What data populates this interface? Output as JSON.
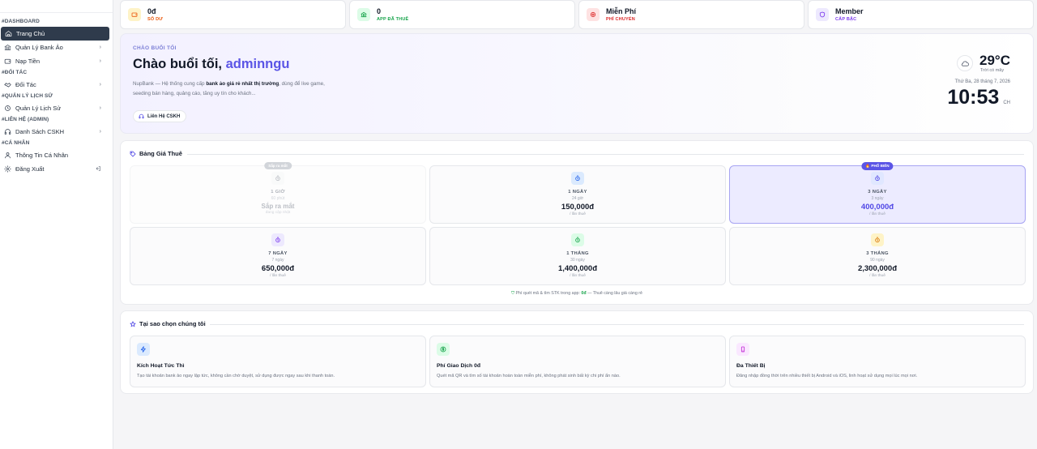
{
  "sidebar": {
    "sections": [
      {
        "title": "#DASHBOARD",
        "items": [
          {
            "label": "Trang Chủ",
            "icon": "home-icon",
            "active": true,
            "chevron": false
          },
          {
            "label": "Quản Lý Bank Ảo",
            "icon": "bank-icon",
            "active": false,
            "chevron": true
          },
          {
            "label": "Nạp Tiền",
            "icon": "wallet-icon",
            "active": false,
            "chevron": true
          }
        ]
      },
      {
        "title": "#ĐỐI TÁC",
        "items": [
          {
            "label": "Đối Tác",
            "icon": "handshake-icon",
            "active": false,
            "chevron": true
          }
        ]
      },
      {
        "title": "#QUẢN LÝ LỊCH SỬ",
        "items": [
          {
            "label": "Quản Lý Lịch Sử",
            "icon": "history-icon",
            "active": false,
            "chevron": true
          }
        ]
      },
      {
        "title": "#LIÊN HỆ (ADMIN)",
        "items": [
          {
            "label": "Danh Sách CSKH",
            "icon": "headset-icon",
            "active": false,
            "chevron": true
          }
        ]
      },
      {
        "title": "#CÁ NHÂN",
        "items": [
          {
            "label": "Thông Tin Cá Nhân",
            "icon": "user-icon",
            "active": false,
            "chevron": false
          },
          {
            "label": "Đăng Xuất",
            "icon": "gear-icon",
            "active": false,
            "chevron": false,
            "trailing": "logout-icon"
          }
        ]
      }
    ]
  },
  "stats": [
    {
      "value": "0đ",
      "label": "SỐ DƯ",
      "icon": "wallet-icon",
      "color": "#ea580c",
      "bg": "#fef3c7"
    },
    {
      "value": "0",
      "label": "APP ĐÃ THUÊ",
      "icon": "bank-icon",
      "color": "#16a34a",
      "bg": "#dcfce7"
    },
    {
      "value": "Miễn Phí",
      "label": "PHÍ CHUYỂN",
      "icon": "target-icon",
      "color": "#dc2626",
      "bg": "#fee2e2"
    },
    {
      "value": "Member",
      "label": "CẤP BẬC",
      "icon": "shield-icon",
      "color": "#7c3aed",
      "bg": "#ede9fe"
    }
  ],
  "hero": {
    "greeting_small": "CHÀO BUỔI TỐI",
    "greeting_prefix": "Chào buổi tối, ",
    "username": "adminngu",
    "desc_pre": "NupBank — Hệ thống cung cấp ",
    "desc_bold": "bank ảo giá rẻ nhất thị trường",
    "desc_post": ", dùng để live game, seeding bán hàng, quảng cáo, tăng uy tín cho khách...",
    "cskh_label": "Liên Hệ CSKH",
    "weather": {
      "temp": "29°C",
      "condition": "Trời có mây",
      "date": "Thứ Ba, 28 tháng 7, 2026",
      "time": "10:53",
      "ampm": "CH"
    }
  },
  "pricing": {
    "title": "Bảng Giá Thuê",
    "plans": [
      {
        "name": "1 GIỜ",
        "sub": "60 phút",
        "price": "Sắp ra mắt",
        "unit": "đang cập nhật",
        "state": "soon",
        "badge": "Sắp ra mắt",
        "color": "#6b7280",
        "bg": "#f3f4f6"
      },
      {
        "name": "1 NGÀY",
        "sub": "24 giờ",
        "price": "150,000đ",
        "unit": "/ lần thuê",
        "state": "normal",
        "badge": "",
        "color": "#2563eb",
        "bg": "#dbeafe"
      },
      {
        "name": "3 NGÀY",
        "sub": "3 ngày",
        "price": "400,000đ",
        "unit": "/ lần thuê",
        "state": "popular",
        "badge": "🔥 PHỔ BIẾN",
        "color": "#4f46e5",
        "bg": "#e0e7ff"
      },
      {
        "name": "7 NGÀY",
        "sub": "7 ngày",
        "price": "650,000đ",
        "unit": "/ lần thuê",
        "state": "normal",
        "badge": "",
        "color": "#7c3aed",
        "bg": "#ede9fe"
      },
      {
        "name": "1 THÁNG",
        "sub": "30 ngày",
        "price": "1,400,000đ",
        "unit": "/ lần thuê",
        "state": "normal",
        "badge": "",
        "color": "#16a34a",
        "bg": "#dcfce7"
      },
      {
        "name": "3 THÁNG",
        "sub": "90 ngày",
        "price": "2,300,000đ",
        "unit": "/ lần thuê",
        "state": "normal",
        "badge": "",
        "color": "#d97706",
        "bg": "#fef3c7"
      }
    ],
    "note_pre": "Phí quét mã & tìm STK trong app: ",
    "note_bold": "0đ",
    "note_post": " — Thuê càng lâu giá càng rẻ"
  },
  "why": {
    "title": "Tại sao chọn chúng tôi",
    "features": [
      {
        "title": "Kích Hoạt Tức Thì",
        "desc": "Tạo tài khoản bank ảo ngay lập tức, không cần chờ duyệt, sử dụng được ngay sau khi thanh toán.",
        "icon": "lightning-icon",
        "color": "#2563eb",
        "bg": "#dbeafe"
      },
      {
        "title": "Phí Giao Dịch 0đ",
        "desc": "Quét mã QR và tìm số tài khoản hoàn toàn miễn phí, không phát sinh bất kỳ chi phí ẩn nào.",
        "icon": "dollar-icon",
        "color": "#16a34a",
        "bg": "#dcfce7"
      },
      {
        "title": "Đa Thiết Bị",
        "desc": "Đăng nhập đồng thời trên nhiều thiết bị Android và iOS, linh hoạt sử dụng mọi lúc mọi nơi.",
        "icon": "phone-icon",
        "color": "#c026d3",
        "bg": "#fae8ff"
      }
    ]
  }
}
